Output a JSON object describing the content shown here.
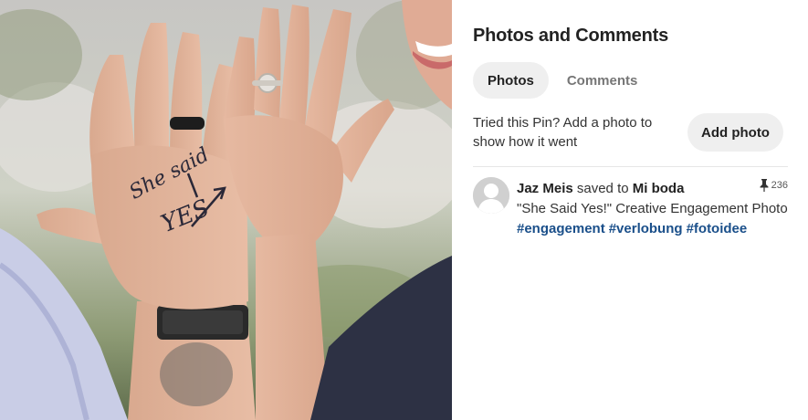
{
  "panel": {
    "title": "Photos and Comments",
    "tabs": [
      {
        "label": "Photos",
        "active": true
      },
      {
        "label": "Comments",
        "active": false
      }
    ],
    "try_text": "Tried this Pin? Add a photo to show how it went",
    "add_photo_label": "Add photo"
  },
  "comment": {
    "user": "Jaz Meis",
    "action": "saved to",
    "board": "Mi boda",
    "pin_count": "236",
    "text": "\"She Said Yes!\" Creative Engagement Photo",
    "tags": [
      "#engagement",
      "#verlobung",
      "#fotoidee"
    ]
  },
  "photo": {
    "handwriting_line1": "She said",
    "handwriting_line2": "YES"
  },
  "colors": {
    "tag": "#1a4f8a",
    "tab_active_bg": "#efefef",
    "button_bg": "#efefef"
  }
}
